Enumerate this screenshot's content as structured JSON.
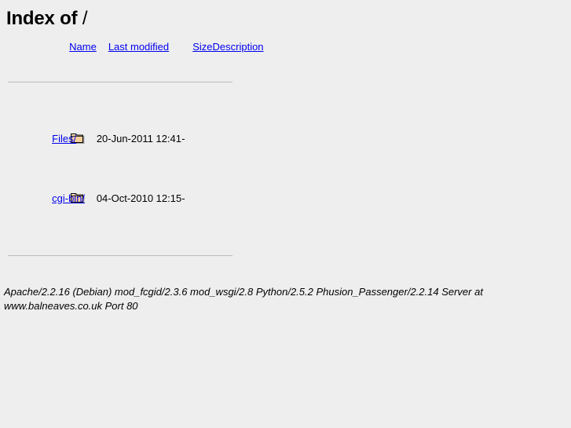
{
  "page": {
    "title_prefix": "Index of",
    "path": "/"
  },
  "table": {
    "headers": [
      {
        "label": "Name",
        "name": "name"
      },
      {
        "label": "Last modified",
        "name": "last-modified"
      },
      {
        "label": "Size",
        "name": "size"
      },
      {
        "label": "Description",
        "name": "description"
      }
    ],
    "rows": [
      {
        "icon": "folder-icon",
        "name": "Files/",
        "name_pad": "   ",
        "last_modified": "20-Jun-2011 12:41",
        "size": "-",
        "description": ""
      },
      {
        "icon": "folder-icon",
        "name": "cgi-bin/",
        "name_pad": " ",
        "last_modified": "04-Oct-2010 12:15",
        "size": "-",
        "description": ""
      }
    ]
  },
  "signature": {
    "text": "Apache/2.2.16 (Debian) mod_fcgid/2.3.6 mod_wsgi/2.8 Python/2.5.2 Phusion_Passenger/2.2.14 Server at www.balneaves.co.uk Port 80"
  },
  "colors": {
    "background": "#eeeeee",
    "link": "#0000ee",
    "text": "#000000",
    "rule": "#bbbbbb",
    "folder_fill": "#f5cf9a",
    "folder_outline": "#000000"
  }
}
